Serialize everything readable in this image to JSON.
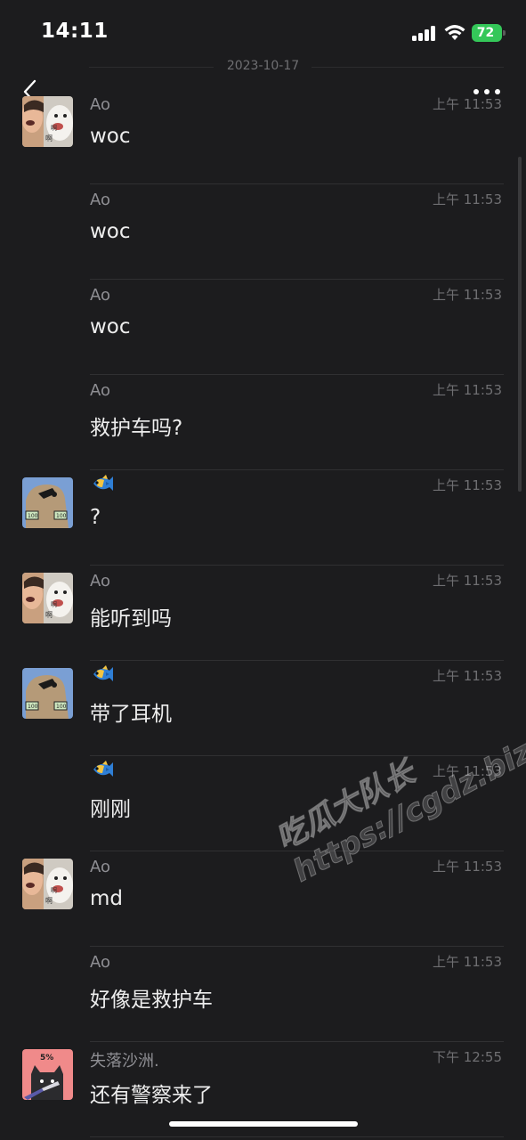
{
  "status_bar": {
    "time": "14:11",
    "battery": "72"
  },
  "chat": {
    "date_separator": "2023-10-17"
  },
  "watermark": {
    "line1": "吃瓜大队长",
    "line2": "https://cgdz.biz"
  },
  "messages": [
    {
      "sender": "Ao",
      "time": "上午 11:53",
      "text": "woc",
      "avatar": "dog-avatar"
    },
    {
      "sender": "Ao",
      "time": "上午 11:53",
      "text": "woc"
    },
    {
      "sender": "Ao",
      "time": "上午 11:53",
      "text": "woc"
    },
    {
      "sender": "Ao",
      "time": "上午 11:53",
      "text": "救护车吗?"
    },
    {
      "sender": "",
      "sender_icon": "fish-emoji",
      "time": "上午 11:53",
      "text": "?",
      "avatar": "capybara-avatar"
    },
    {
      "sender": "Ao",
      "time": "上午 11:53",
      "text": "能听到吗",
      "avatar": "dog-avatar"
    },
    {
      "sender": "",
      "sender_icon": "fish-emoji",
      "time": "上午 11:53",
      "text": "带了耳机",
      "avatar": "capybara-avatar"
    },
    {
      "sender": "",
      "sender_icon": "fish-emoji",
      "time": "上午 11:53",
      "text": "刚刚"
    },
    {
      "sender": "Ao",
      "time": "上午 11:53",
      "text": "md",
      "avatar": "dog-avatar"
    },
    {
      "sender": "Ao",
      "time": "上午 11:53",
      "text": "好像是救护车"
    },
    {
      "sender": "失落沙洲.",
      "time": "下午 12:55",
      "text": "还有警察来了",
      "avatar": "cat-avatar"
    }
  ]
}
